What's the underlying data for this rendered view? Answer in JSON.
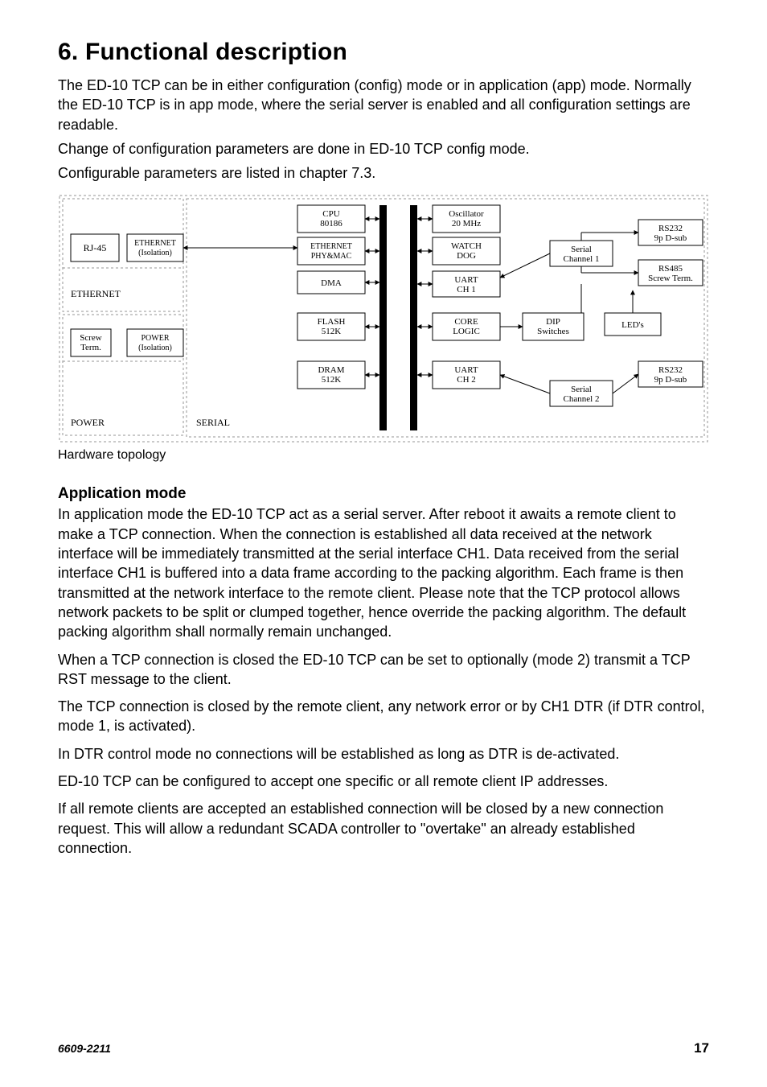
{
  "title": "6. Functional description",
  "para1": "The ED-10 TCP can be in either configuration (config) mode or in application (app) mode. Normally the ED-10 TCP is in app mode, where the serial server is enabled and all configuration settings are readable.",
  "para2": "Change of configuration parameters are done in ED-10 TCP config mode.",
  "para3": "Configurable parameters are listed in chapter 7.3.",
  "fig_caption": "Hardware topology",
  "app_mode_heading": "Application mode",
  "app1": "In application mode the ED-10 TCP act as a serial server. After reboot it awaits a remote client to make a TCP connection. When the connection is established all data received at the network interface will be immediately transmitted at the serial interface CH1. Data received from the serial interface CH1 is buffered into a data frame according to the packing algorithm. Each frame is then transmitted at the network interface to the remote client. Please note that the TCP protocol allows network packets to be split or clumped together, hence override the packing algorithm. The default packing algorithm shall normally remain unchanged.",
  "app2": "When a TCP connection is closed the ED-10 TCP can be set to optionally (mode 2) transmit a TCP RST message to the client.",
  "app3": "The TCP connection is closed by the remote client, any network error or by CH1 DTR (if DTR control, mode 1, is activated).",
  "app4": "In DTR control mode no connections will be established as long as DTR is de-activated.",
  "app5": "ED-10 TCP can be configured to accept one specific or all remote client IP addresses.",
  "app6": "If all remote clients are accepted an established connection will be closed by a new connection request. This will allow a redundant SCADA controller to \"overtake\" an already established connection.",
  "footer_docnum": "6609-2211",
  "footer_pagenum": "17",
  "diagram": {
    "section_labels": {
      "ethernet": "ETHERNET",
      "power": "POWER",
      "serial": "SERIAL"
    },
    "left": {
      "rj45": "RJ-45",
      "eth_iso": {
        "l1": "ETHERNET",
        "l2": "(Isolation)"
      },
      "screw": {
        "l1": "Screw",
        "l2": "Term."
      },
      "power_iso": {
        "l1": "POWER",
        "l2": "(Isolation)"
      }
    },
    "center_left": {
      "cpu": {
        "l1": "CPU",
        "l2": "80186"
      },
      "phymac": {
        "l1": "ETHERNET",
        "l2": "PHY&MAC"
      },
      "dma": "DMA",
      "flash": {
        "l1": "FLASH",
        "l2": "512K"
      },
      "dram": {
        "l1": "DRAM",
        "l2": "512K"
      }
    },
    "center_right": {
      "osc": {
        "l1": "Oscillator",
        "l2": "20 MHz"
      },
      "wdog": {
        "l1": "WATCH",
        "l2": "DOG"
      },
      "uart1": {
        "l1": "UART",
        "l2": "CH 1"
      },
      "core": {
        "l1": "CORE",
        "l2": "LOGIC"
      },
      "uart2": {
        "l1": "UART",
        "l2": "CH 2"
      }
    },
    "right": {
      "dip": {
        "l1": "DIP",
        "l2": "Switches"
      },
      "leds": "LED's",
      "serial1": {
        "l1": "Serial",
        "l2": "Channel 1"
      },
      "serial2": {
        "l1": "Serial",
        "l2": "Channel 2"
      },
      "rs232a": {
        "l1": "RS232",
        "l2": "9p D-sub"
      },
      "rs485": {
        "l1": "RS485",
        "l2": "Screw Term."
      },
      "rs232b": {
        "l1": "RS232",
        "l2": "9p D-sub"
      }
    }
  }
}
